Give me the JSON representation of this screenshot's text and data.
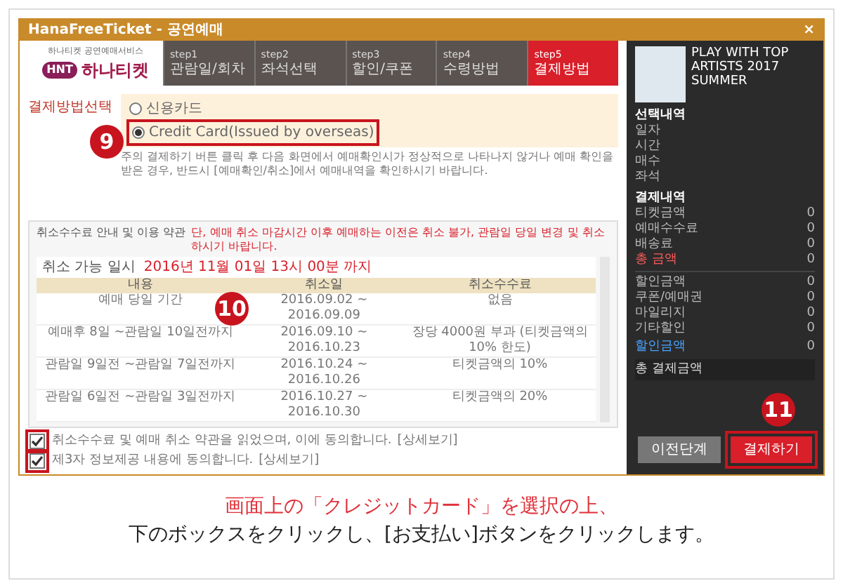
{
  "window": {
    "title": "HanaFreeTicket - 공연예매",
    "close": "×"
  },
  "logo": {
    "tagline": "하나티켓 공연예매서비스",
    "badge": "HNT",
    "name": "하나티켓"
  },
  "steps": [
    {
      "step": "step1",
      "label": "관람일/회차",
      "selected": false
    },
    {
      "step": "step2",
      "label": "좌석선택",
      "selected": false
    },
    {
      "step": "step3",
      "label": "할인/쿠폰",
      "selected": false
    },
    {
      "step": "step4",
      "label": "수령방법",
      "selected": false
    },
    {
      "step": "step5",
      "label": "결제방법",
      "selected": true
    }
  ],
  "payment": {
    "label": "결제방법선택",
    "callout": "9",
    "options": [
      {
        "label": "신용카드",
        "selected": false
      },
      {
        "label": "Credit Card(Issued by overseas)",
        "selected": true
      }
    ],
    "note": "주의 결제하기 버튼 클릭 후 다음 화면에서 예매확인시가 정상적으로 나타나지 않거나 예매 확인을 받은 경우, 반드시 [예매확인/취소]에서 예매내역을 확인하시기 바랍니다."
  },
  "cancellation": {
    "title": "취소수수료 안내 및 이용 약관",
    "notice": "단, 예매 취소 마감시간 이후 예매하는 이전은 취소 불가, 관람일 당일 변경 및 취소하시기 바랍니다.",
    "deadline_label": "취소 가능 일시",
    "deadline": "2016년 11월 01일 13시 00분 까지",
    "callout": "10",
    "columns": [
      "내용",
      "취소일",
      "취소수수료"
    ],
    "rows": [
      [
        "예매 당일 기간",
        "2016.09.02 ~ 2016.09.09",
        "없음"
      ],
      [
        "예매후 8일 ~관람일 10일전까지",
        "2016.09.10 ~ 2016.10.23",
        "장당 4000원 부과 (티켓금액의 10% 한도)"
      ],
      [
        "관람일 9일전 ~관람일 7일전까지",
        "2016.10.24 ~ 2016.10.26",
        "티켓금액의 10%"
      ],
      [
        "관람일 6일전 ~관람일 3일전까지",
        "2016.10.27 ~ 2016.10.30",
        "티켓금액의 20%"
      ]
    ]
  },
  "agreements": [
    {
      "text": "취소수수료 및 예매 취소 약관을 읽었으며, 이에 동의합니다.",
      "link": "[상세보기]",
      "checked": true
    },
    {
      "text": "제3자 정보제공 내용에 동의합니다.",
      "link": "[상세보기]",
      "checked": true
    }
  ],
  "sidebar": {
    "title": "PLAY WITH TOP ARTISTS 2017 SUMMER",
    "selection_title": "선택내역",
    "selection": [
      "일자",
      "시간",
      "매수",
      "좌석"
    ],
    "payment_title": "결제내역",
    "charges": [
      {
        "label": "티켓금액",
        "value": "0"
      },
      {
        "label": "예매수수료",
        "value": "0"
      },
      {
        "label": "배송료",
        "value": "0"
      },
      {
        "label": "총 금액",
        "value": "0"
      }
    ],
    "discounts": [
      {
        "label": "할인금액",
        "value": "0"
      },
      {
        "label": "쿠폰/예매권",
        "value": "0"
      },
      {
        "label": "마일리지",
        "value": "0"
      },
      {
        "label": "기타할인",
        "value": "0"
      }
    ],
    "discount_total": {
      "label": "할인금액",
      "value": "0"
    },
    "grand_total": {
      "label": "총 결제금액"
    }
  },
  "buttons": [
    {
      "label": "이전단계",
      "kind": "secondary"
    },
    {
      "label": "결제하기",
      "kind": "primary",
      "callout": "11"
    }
  ],
  "caption": [
    {
      "text": "画面上の「クレジットカード」を選択の上、",
      "color": "#e0303a"
    },
    {
      "text": "下のボックスをクリックし、[お支払い]ボタンをクリックします。",
      "color": "#222222"
    }
  ]
}
